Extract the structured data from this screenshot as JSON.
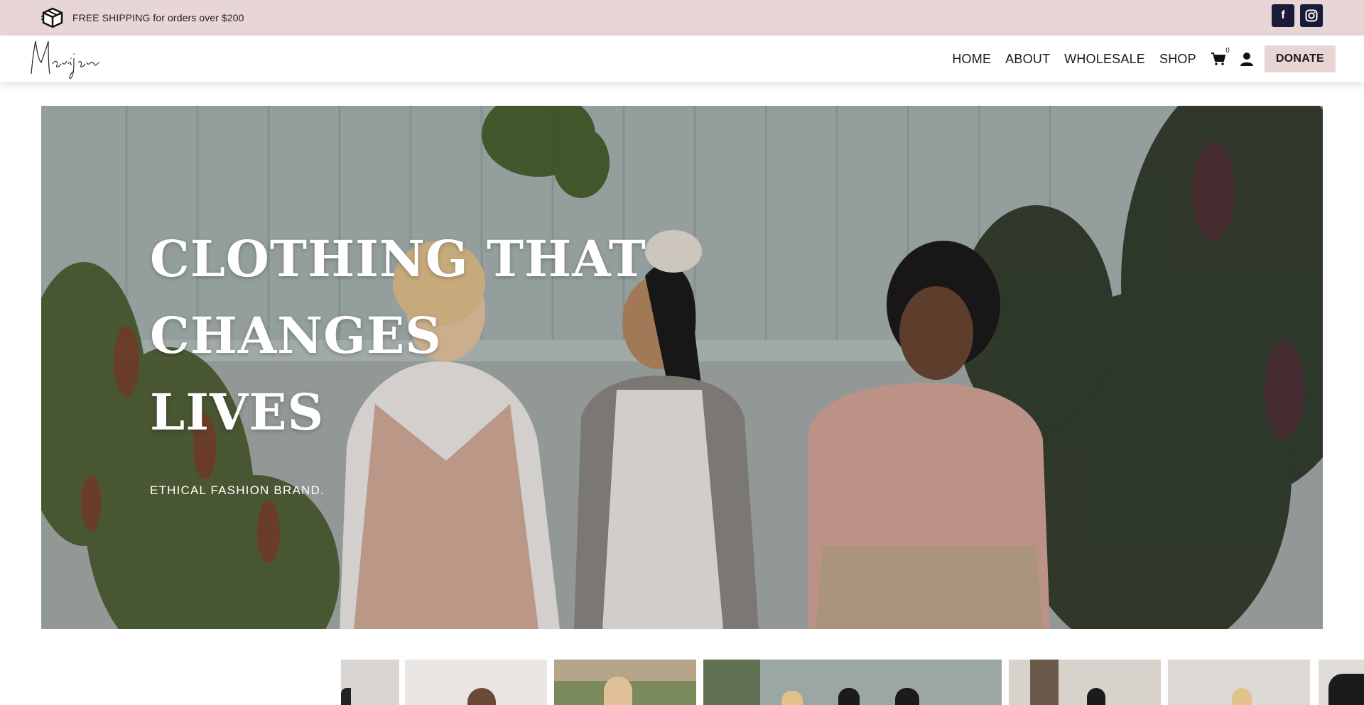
{
  "topbar": {
    "shipping_text": "FREE SHIPPING for orders over $200",
    "background": "#e8d6d6",
    "socials": [
      {
        "icon": "facebook-icon",
        "glyph": "f"
      },
      {
        "icon": "instagram-icon",
        "glyph": "◎"
      }
    ]
  },
  "header": {
    "logo_text": "Marijana",
    "nav": [
      {
        "label": "HOME"
      },
      {
        "label": "ABOUT"
      },
      {
        "label": "WHOLESALE"
      },
      {
        "label": "SHOP"
      }
    ],
    "cart_count": "0",
    "donate_label": "DONATE"
  },
  "hero": {
    "title_lines": [
      "CLOTHING THAT",
      "CHANGES",
      "LIVES"
    ],
    "subtitle": "ETHICAL FASHION BRAND."
  },
  "colors": {
    "accent": "#e8d6d6",
    "social_bg": "#1a1a3a"
  }
}
